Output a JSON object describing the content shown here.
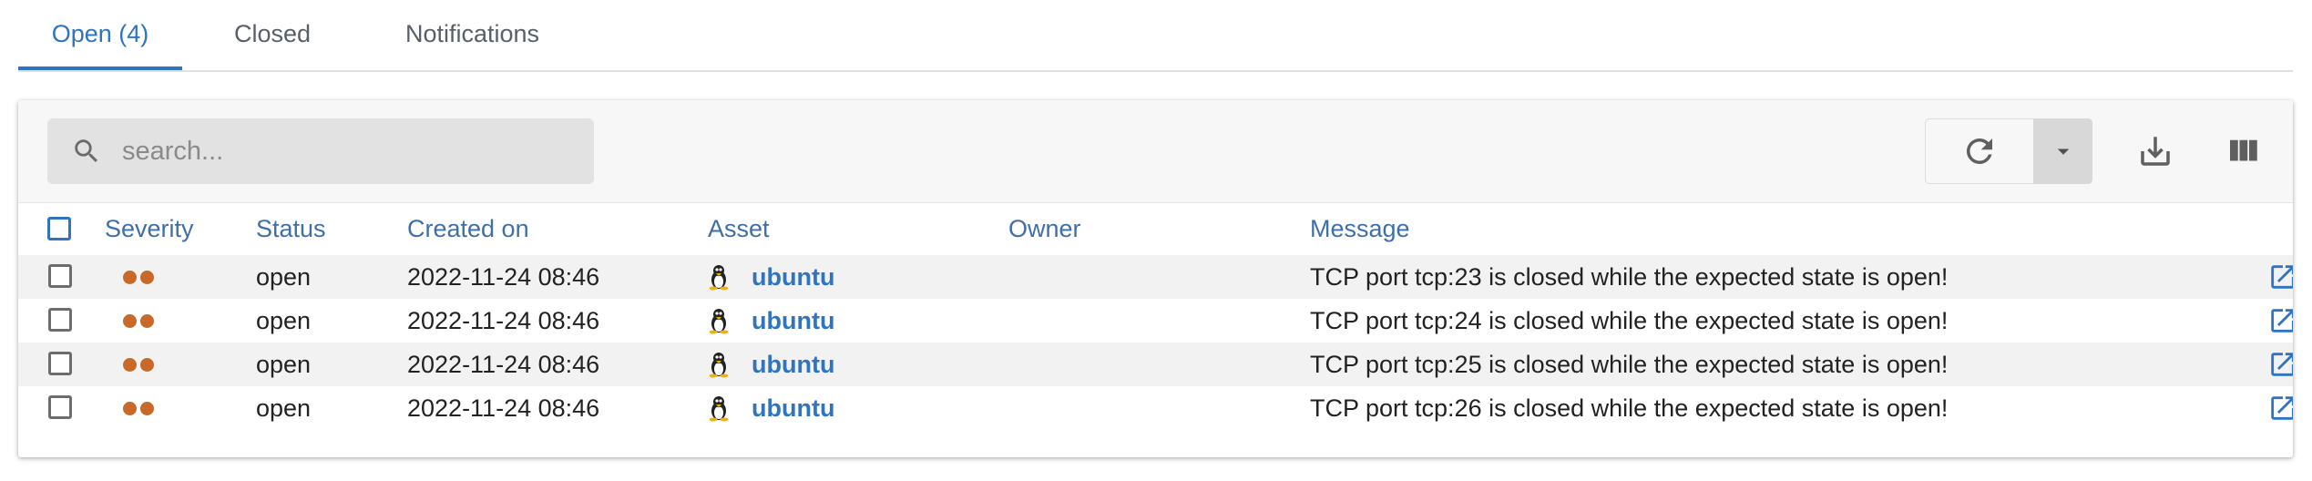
{
  "tabs": [
    {
      "label": "Open (4)",
      "active": true
    },
    {
      "label": "Closed",
      "active": false
    },
    {
      "label": "Notifications",
      "active": false
    }
  ],
  "search": {
    "placeholder": "search...",
    "value": ""
  },
  "toolbar": {
    "icons": [
      "refresh-icon",
      "caret-down-icon",
      "download-icon",
      "columns-icon"
    ]
  },
  "table": {
    "headers": {
      "severity": "Severity",
      "status": "Status",
      "created_on": "Created on",
      "asset": "Asset",
      "owner": "Owner",
      "message": "Message"
    },
    "rows": [
      {
        "severity_dots": 2,
        "status": "open",
        "created_on": "2022-11-24 08:46",
        "asset_icon": "linux-tux-icon",
        "asset": "ubuntu",
        "owner": "",
        "message": "TCP port tcp:23 is closed while the expected state is open!"
      },
      {
        "severity_dots": 2,
        "status": "open",
        "created_on": "2022-11-24 08:46",
        "asset_icon": "linux-tux-icon",
        "asset": "ubuntu",
        "owner": "",
        "message": "TCP port tcp:24 is closed while the expected state is open!"
      },
      {
        "severity_dots": 2,
        "status": "open",
        "created_on": "2022-11-24 08:46",
        "asset_icon": "linux-tux-icon",
        "asset": "ubuntu",
        "owner": "",
        "message": "TCP port tcp:25 is closed while the expected state is open!"
      },
      {
        "severity_dots": 2,
        "status": "open",
        "created_on": "2022-11-24 08:46",
        "asset_icon": "linux-tux-icon",
        "asset": "ubuntu",
        "owner": "",
        "message": "TCP port tcp:26 is closed while the expected state is open!"
      }
    ]
  },
  "colors": {
    "accent": "#2f73c1",
    "header_text": "#3f6fa8",
    "severity_dot": "#c76a29",
    "row_shade": "#f2f2f2"
  }
}
